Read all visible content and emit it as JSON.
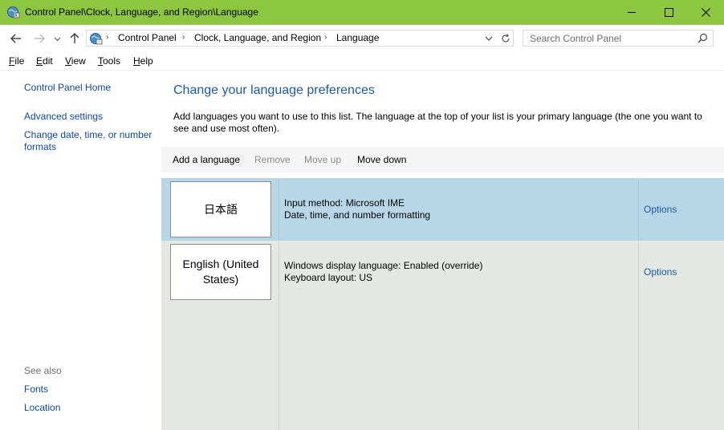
{
  "window": {
    "title": "Control Panel\\Clock, Language, and Region\\Language",
    "titlebar_color": "#8dc63f",
    "controls": {
      "minimize": "minimize-icon",
      "maximize": "maximize-icon",
      "close": "close-icon"
    }
  },
  "address": {
    "crumbs": [
      "Control Panel",
      "Clock, Language, and Region",
      "Language"
    ],
    "separator": "›",
    "search_placeholder": "Search Control Panel"
  },
  "menu": {
    "items": [
      "File",
      "Edit",
      "View",
      "Tools",
      "Help"
    ],
    "access_keys": [
      "F",
      "E",
      "V",
      "T",
      "H"
    ]
  },
  "sidebar": {
    "home": "Control Panel Home",
    "links": [
      "Advanced settings",
      "Change date, time, or number formats"
    ],
    "see_also_label": "See also",
    "see_also": [
      "Fonts",
      "Location"
    ]
  },
  "main": {
    "heading": "Change your language preferences",
    "description": "Add languages you want to use to this list. The language at the top of your list is your primary language (the one you want to see and use most often).",
    "toolbar": {
      "add": "Add a language",
      "remove": "Remove",
      "move_up": "Move up",
      "move_down": "Move down"
    },
    "languages": [
      {
        "name": "日本語",
        "line1": "Input method: Microsoft IME",
        "line2": "Date, time, and number formatting",
        "options": "Options",
        "selected": true
      },
      {
        "name": "English (United States)",
        "line1": "Windows display language: Enabled (override)",
        "line2": "Keyboard layout: US",
        "options": "Options",
        "selected": false
      }
    ]
  },
  "colors": {
    "link": "#0d47a1",
    "heading": "#1a5aa8",
    "selected_row": "#b7d7e8",
    "list_bg": "#e3e9e2"
  }
}
